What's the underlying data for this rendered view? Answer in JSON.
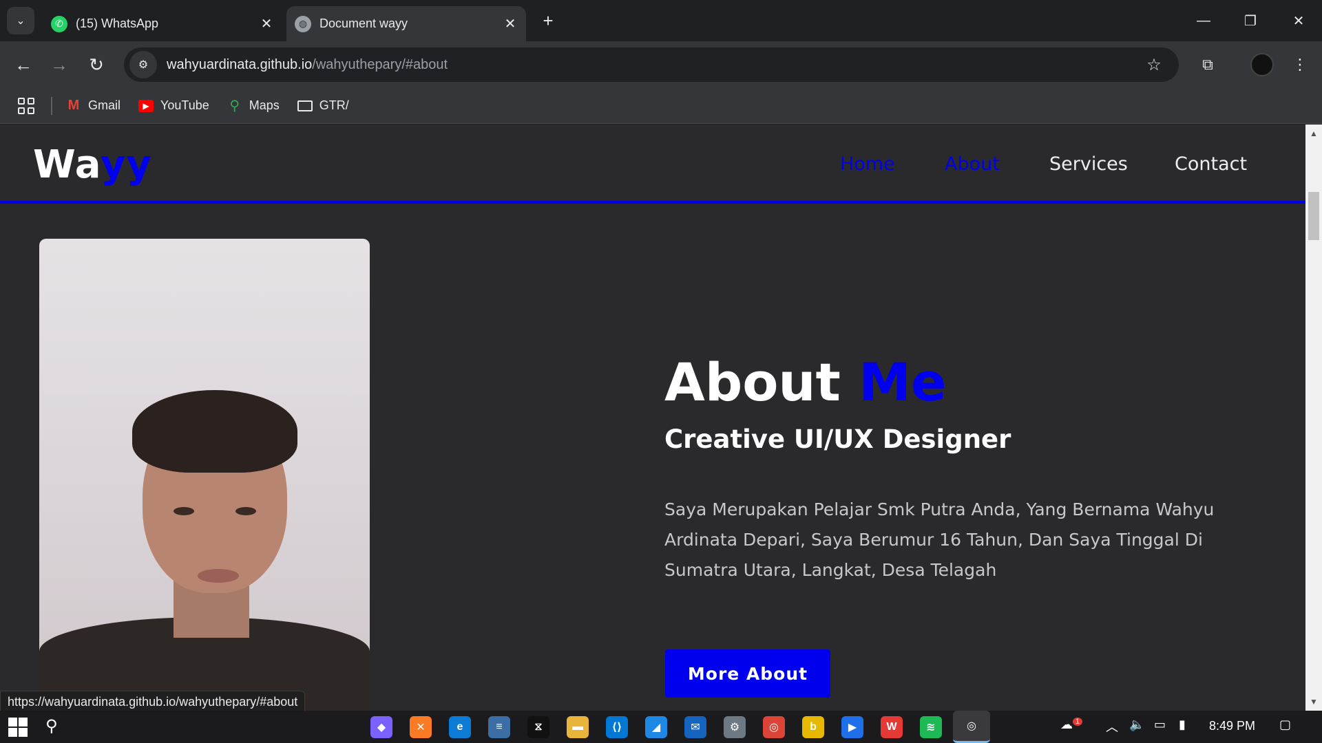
{
  "browser": {
    "tabs": [
      {
        "title": "(15) WhatsApp",
        "active": false,
        "icon": "whatsapp-icon"
      },
      {
        "title": "Document wayy",
        "active": true,
        "icon": "globe-icon"
      }
    ],
    "address": {
      "host": "wahyuardinata.github.io",
      "path": "/wahyuthepary/#about"
    },
    "bookmarks": [
      {
        "label": "Gmail",
        "icon": "gmail-icon"
      },
      {
        "label": "YouTube",
        "icon": "youtube-icon"
      },
      {
        "label": "Maps",
        "icon": "maps-icon"
      },
      {
        "label": "GTR/",
        "icon": "folder-icon"
      }
    ],
    "status_url": "https://wahyuardinata.github.io/wahyuthepary/#about"
  },
  "site": {
    "logo": {
      "part1": "Wa",
      "part2": "yy"
    },
    "nav": [
      {
        "label": "Home",
        "color": "#0000ee"
      },
      {
        "label": "About",
        "color": "#0000ee"
      },
      {
        "label": "Services",
        "color": "#eeeeee"
      },
      {
        "label": "Contact",
        "color": "#eeeeee"
      }
    ],
    "about": {
      "title_main": "About",
      "title_accent": "Me",
      "subtitle": "Creative UI/UX Designer",
      "text": "Saya Merupakan Pelajar Smk Putra Anda, Yang Bernama Wahyu Ardinata Depari, Saya Berumur 16 Tahun, Dan Saya Tinggal Di Sumatra Utara, Langkat, Desa Telagah",
      "button": "More About"
    },
    "accent_color": "#0000ee"
  },
  "taskbar": {
    "clock": "8:49 PM",
    "weather_badge": "1"
  }
}
